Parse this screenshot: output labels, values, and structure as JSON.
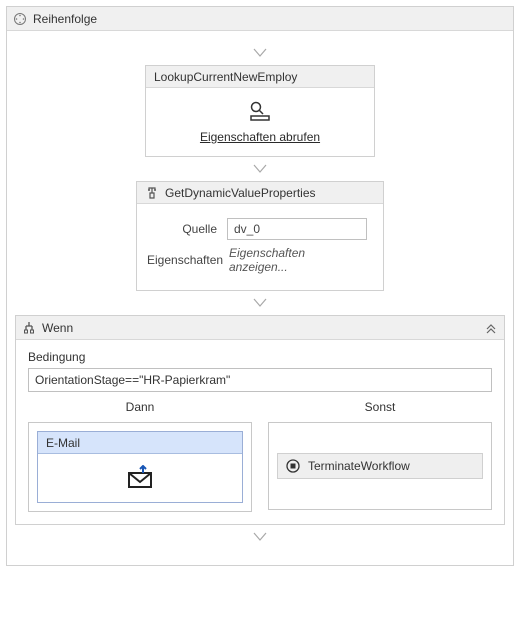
{
  "root": {
    "title": "Reihenfolge"
  },
  "lookup": {
    "title": "LookupCurrentNewEmploy",
    "link": "Eigenschaften abrufen"
  },
  "dynamic": {
    "title": "GetDynamicValueProperties",
    "sourceLabel": "Quelle",
    "sourceValue": "dv_0",
    "propsLabel": "Eigenschaften",
    "propsLink": "Eigenschaften anzeigen..."
  },
  "wenn": {
    "title": "Wenn",
    "conditionLabel": "Bedingung",
    "condition": "OrientationStage==\"HR-Papierkram\"",
    "thenLabel": "Dann",
    "elseLabel": "Sonst"
  },
  "email": {
    "title": "E-Mail"
  },
  "terminate": {
    "title": "TerminateWorkflow"
  }
}
